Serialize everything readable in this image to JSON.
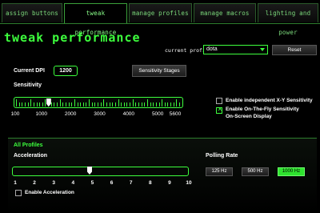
{
  "tabs": [
    {
      "label": "assign buttons",
      "active": false
    },
    {
      "label": "tweak performance",
      "active": true
    },
    {
      "label": "manage profiles",
      "active": false
    },
    {
      "label": "manage macros",
      "active": false
    },
    {
      "label": "lighting and power",
      "active": false
    }
  ],
  "page_title": "tweak performance",
  "profile": {
    "label": "current profile",
    "value": "dota",
    "reset_label": "Reset"
  },
  "dpi": {
    "label": "Current DPI",
    "value": "1200",
    "stages_button": "Sensitivity Stages"
  },
  "sensitivity": {
    "label": "Sensitivity",
    "min": 100,
    "max": 5600,
    "value": 1200,
    "scale_labels": [
      "100",
      "1000",
      "2000",
      "3000",
      "4000",
      "5000",
      "5600"
    ]
  },
  "options": {
    "independent_xy": {
      "label": "Enable independent X-Y Sensitivity",
      "checked": false
    },
    "on_the_fly": {
      "label_line1": "Enable On-The-Fly Sensitivity",
      "label_line2": "On-Screen Display",
      "checked": true
    }
  },
  "all_profiles": {
    "header": "All Profiles",
    "acceleration": {
      "label": "Acceleration",
      "min": 1,
      "max": 10,
      "value": 5,
      "scale_labels": [
        "1",
        "2",
        "3",
        "4",
        "5",
        "6",
        "7",
        "8",
        "9",
        "10"
      ],
      "enable_label": "Enable Acceleration",
      "enabled": false
    },
    "polling": {
      "label": "Polling Rate",
      "options": [
        "125 Hz",
        "500 Hz",
        "1000 Hz"
      ],
      "selected": "1000 Hz"
    }
  },
  "colors": {
    "accent": "#3dff3d",
    "background": "#000000",
    "selected_button": "#2fe32f"
  }
}
